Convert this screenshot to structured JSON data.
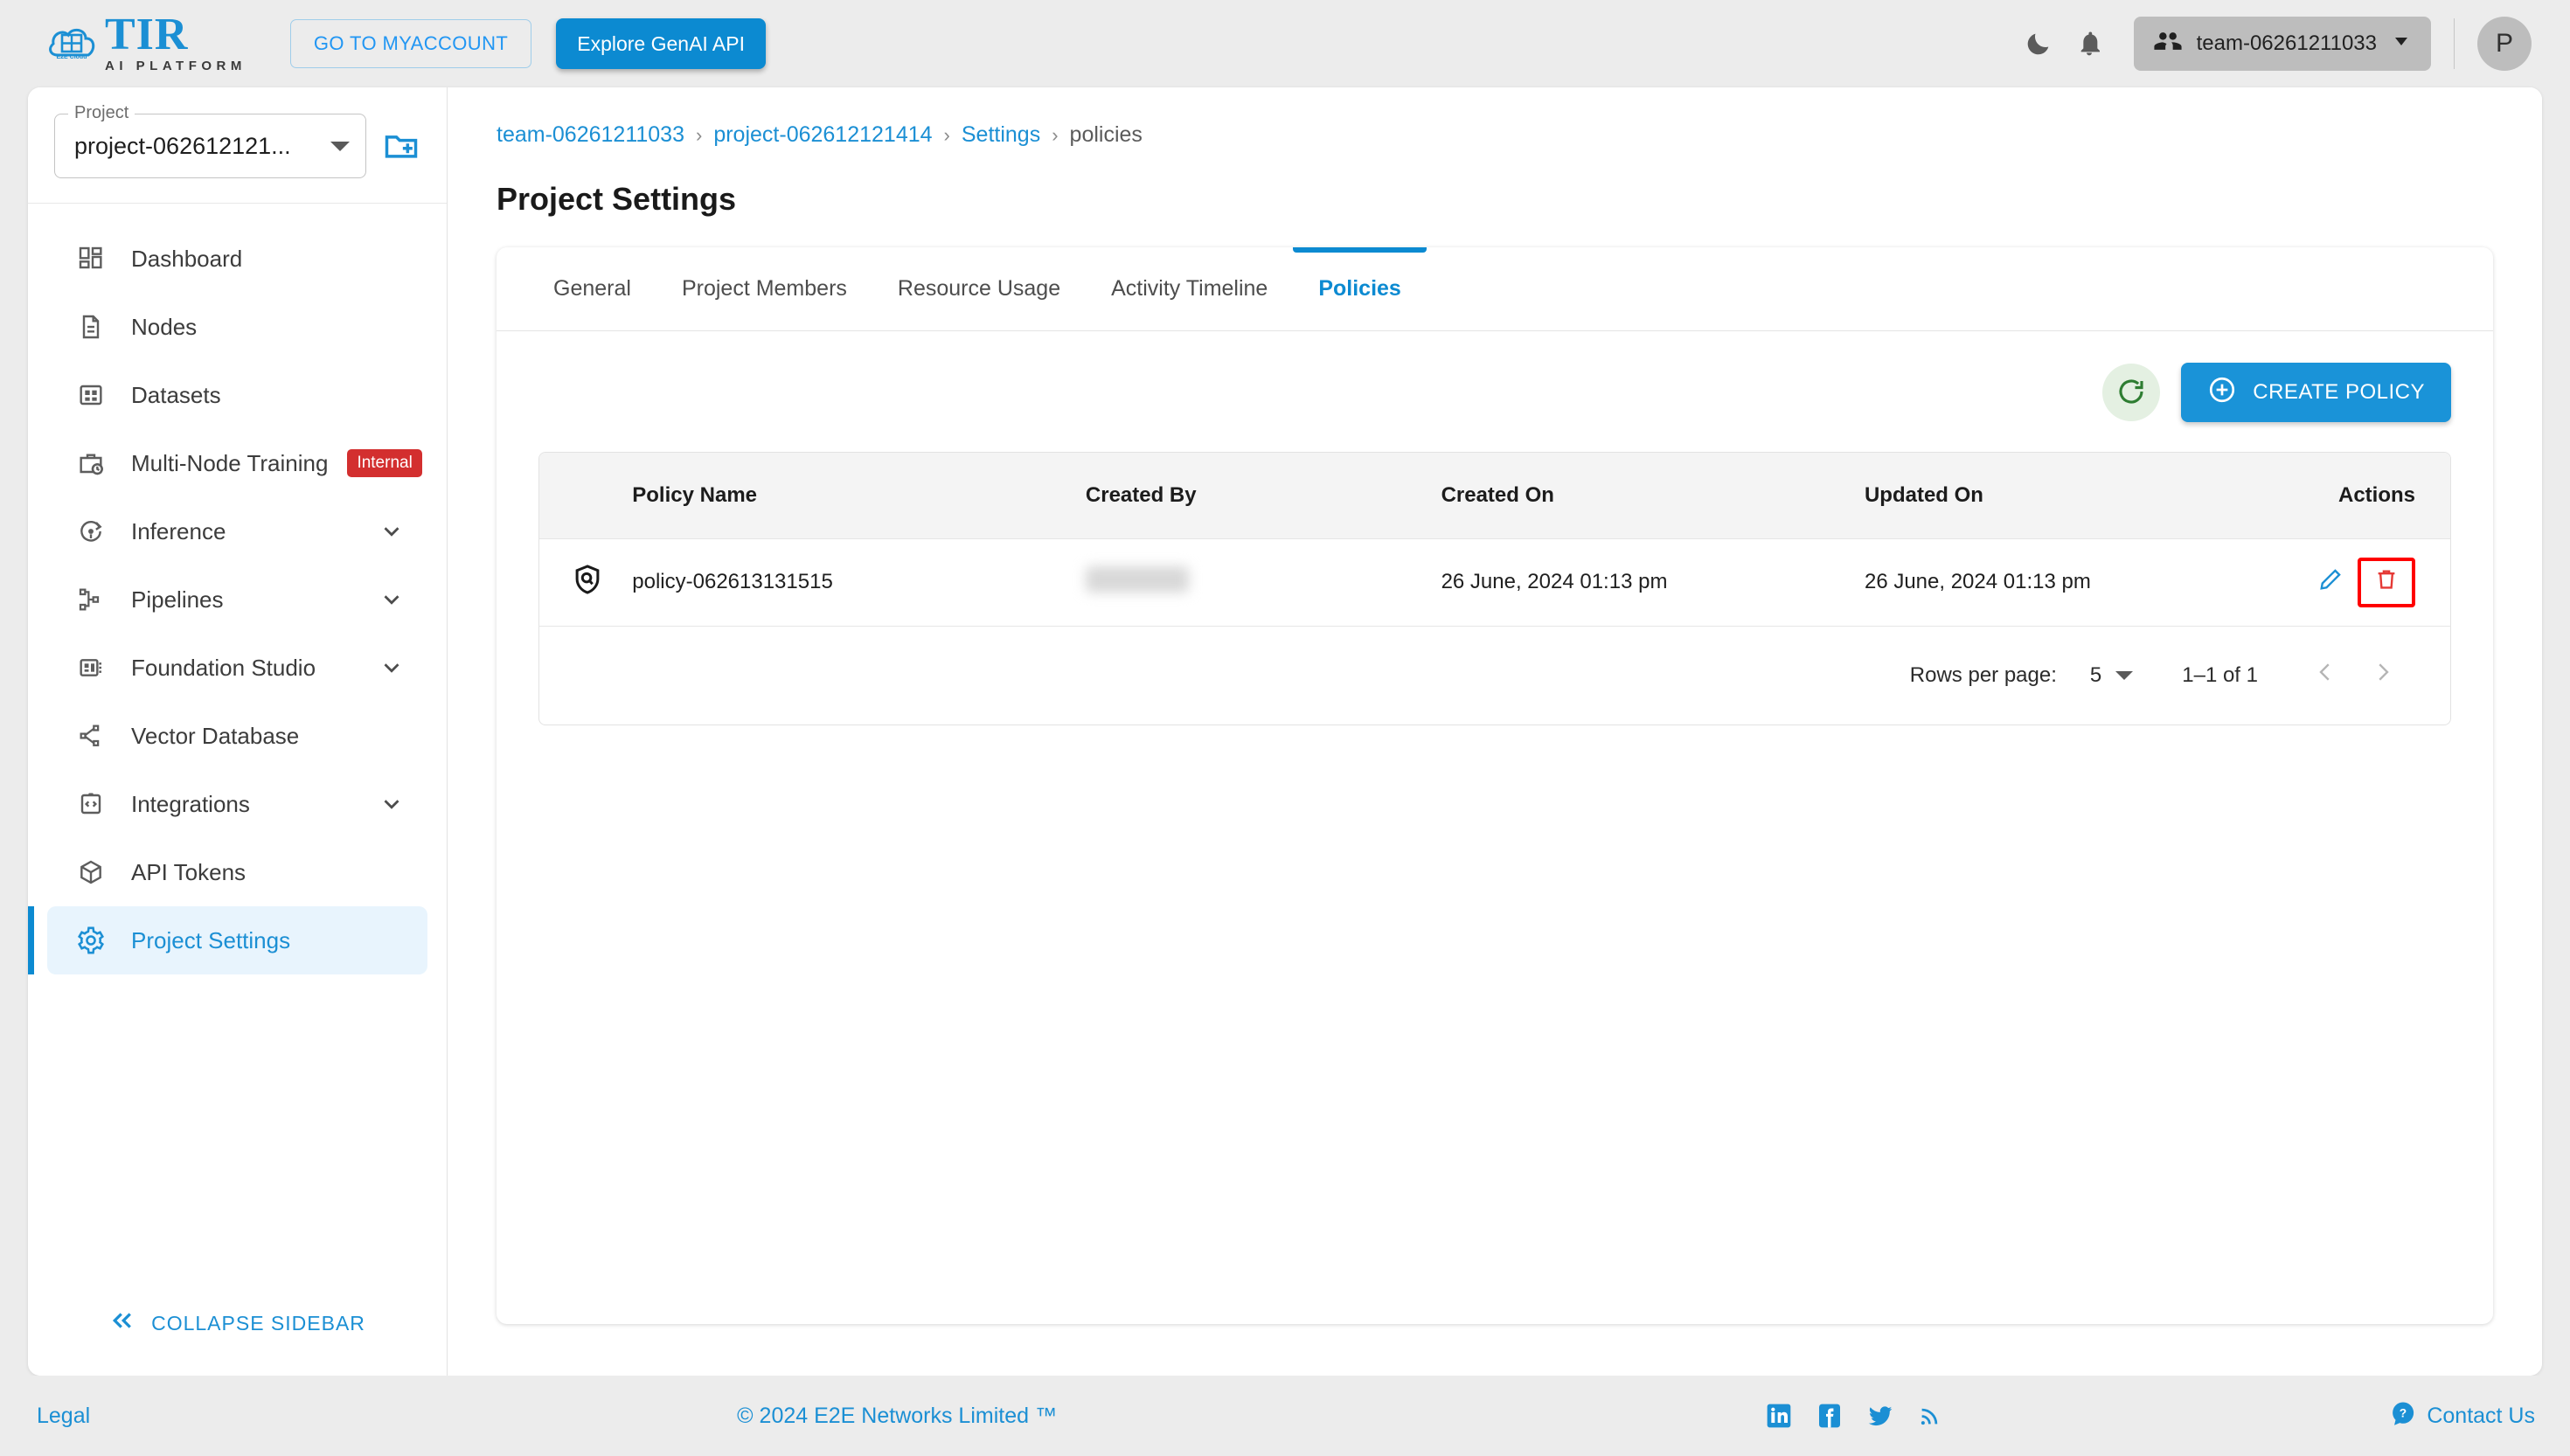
{
  "brand": {
    "name": "TIR",
    "tagline": "AI PLATFORM",
    "logo_label": "E2E Cloud"
  },
  "topbar": {
    "myaccount_label": "GO TO MYACCOUNT",
    "genai_label": "Explore GenAI API",
    "dark_mode_icon": "moon-icon",
    "notification_icon": "bell-icon",
    "team_name": "team-06261211033",
    "avatar_initial": "P"
  },
  "sidebar": {
    "project_legend": "Project",
    "project_value": "project-062612121...",
    "new_project_icon": "new-folder-icon",
    "items": [
      {
        "label": "Dashboard",
        "icon": "dashboard-icon",
        "expandable": false,
        "active": false,
        "badge": ""
      },
      {
        "label": "Nodes",
        "icon": "document-icon",
        "expandable": false,
        "active": false,
        "badge": ""
      },
      {
        "label": "Datasets",
        "icon": "grid-icon",
        "expandable": false,
        "active": false,
        "badge": ""
      },
      {
        "label": "Multi-Node Training",
        "icon": "briefcase-clock-icon",
        "expandable": false,
        "active": false,
        "badge": "Internal"
      },
      {
        "label": "Inference",
        "icon": "inference-icon",
        "expandable": true,
        "active": false,
        "badge": ""
      },
      {
        "label": "Pipelines",
        "icon": "pipelines-icon",
        "expandable": true,
        "active": false,
        "badge": ""
      },
      {
        "label": "Foundation Studio",
        "icon": "chip-icon",
        "expandable": true,
        "active": false,
        "badge": ""
      },
      {
        "label": "Vector Database",
        "icon": "share-nodes-icon",
        "expandable": false,
        "active": false,
        "badge": ""
      },
      {
        "label": "Integrations",
        "icon": "code-brackets-icon",
        "expandable": true,
        "active": false,
        "badge": ""
      },
      {
        "label": "API Tokens",
        "icon": "cube-icon",
        "expandable": false,
        "active": false,
        "badge": ""
      },
      {
        "label": "Project Settings",
        "icon": "gear-icon",
        "expandable": false,
        "active": true,
        "badge": ""
      }
    ],
    "collapse_label": "COLLAPSE SIDEBAR"
  },
  "breadcrumb": {
    "team": "team-06261211033",
    "project": "project-062612121414",
    "settings": "Settings",
    "current": "policies",
    "separator": "›"
  },
  "page": {
    "title": "Project Settings"
  },
  "tabs": [
    {
      "label": "General",
      "active": false
    },
    {
      "label": "Project Members",
      "active": false
    },
    {
      "label": "Resource Usage",
      "active": false
    },
    {
      "label": "Activity Timeline",
      "active": false
    },
    {
      "label": "Policies",
      "active": true
    }
  ],
  "toolbar": {
    "refresh_icon": "refresh-icon",
    "create_label": "CREATE POLICY",
    "create_icon": "plus-circle-icon"
  },
  "table": {
    "columns": [
      "Policy Name",
      "Created By",
      "Created On",
      "Updated On",
      "Actions"
    ],
    "rows": [
      {
        "icon": "shield-search-icon",
        "policy_name": "policy-062613131515",
        "created_by": "",
        "created_by_redacted": true,
        "created_on": "26 June, 2024 01:13 pm",
        "updated_on": "26 June, 2024 01:13 pm",
        "edit_icon": "pencil-icon",
        "delete_icon": "trash-icon"
      }
    ]
  },
  "pagination": {
    "rows_per_page_label": "Rows per page:",
    "rows_per_page_value": "5",
    "range": "1–1 of 1",
    "prev_icon": "chevron-left-icon",
    "next_icon": "chevron-right-icon"
  },
  "footer": {
    "legal": "Legal",
    "copyright": "© 2024 E2E Networks Limited ™",
    "social": [
      "linkedin-icon",
      "facebook-icon",
      "twitter-icon",
      "rss-icon"
    ],
    "contact_label": "Contact Us",
    "contact_icon": "help-circle-icon"
  },
  "colors": {
    "accent": "#0c8ad1",
    "link": "#1b8fd4",
    "danger": "#d32f2f",
    "highlight_box": "#ff0000",
    "page_bg": "#ececec"
  }
}
